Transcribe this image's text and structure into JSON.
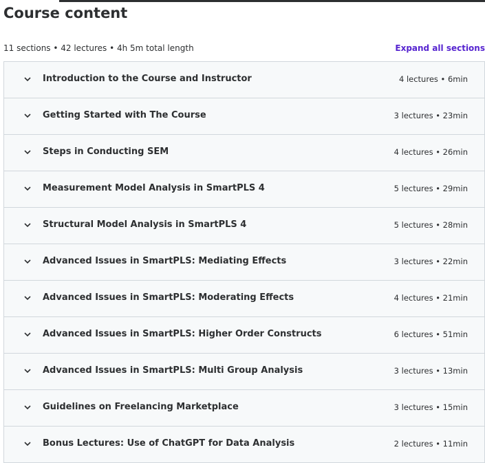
{
  "header": {
    "title": "Course content",
    "summary": "11 sections • 42 lectures • 4h 5m total length",
    "expand_label": "Expand all sections"
  },
  "colors": {
    "accent": "#5624d0",
    "text": "#2d2f31",
    "section_bg": "#f7f9fa",
    "border": "#d1d7dc"
  },
  "sections": [
    {
      "title": "Introduction to the Course and Instructor",
      "meta": "4 lectures • 6min",
      "icon": "chevron-down-icon"
    },
    {
      "title": "Getting Started with The Course",
      "meta": "3 lectures • 23min",
      "icon": "chevron-down-icon"
    },
    {
      "title": "Steps in Conducting SEM",
      "meta": "4 lectures • 26min",
      "icon": "chevron-down-icon"
    },
    {
      "title": "Measurement Model Analysis in SmartPLS 4",
      "meta": "5 lectures • 29min",
      "icon": "chevron-down-icon"
    },
    {
      "title": "Structural Model Analysis in SmartPLS 4",
      "meta": "5 lectures • 28min",
      "icon": "chevron-down-icon"
    },
    {
      "title": "Advanced Issues in SmartPLS: Mediating Effects",
      "meta": "3 lectures • 22min",
      "icon": "chevron-down-icon"
    },
    {
      "title": "Advanced Issues in SmartPLS: Moderating Effects",
      "meta": "4 lectures • 21min",
      "icon": "chevron-down-icon"
    },
    {
      "title": "Advanced Issues in SmartPLS: Higher Order Constructs",
      "meta": "6 lectures • 51min",
      "icon": "chevron-down-icon"
    },
    {
      "title": "Advanced Issues in SmartPLS: Multi Group Analysis",
      "meta": "3 lectures • 13min",
      "icon": "chevron-down-icon"
    },
    {
      "title": "Guidelines on Freelancing Marketplace",
      "meta": "3 lectures • 15min",
      "icon": "chevron-down-icon"
    },
    {
      "title": "Bonus Lectures: Use of ChatGPT for Data Analysis",
      "meta": "2 lectures • 11min",
      "icon": "chevron-down-icon"
    }
  ]
}
